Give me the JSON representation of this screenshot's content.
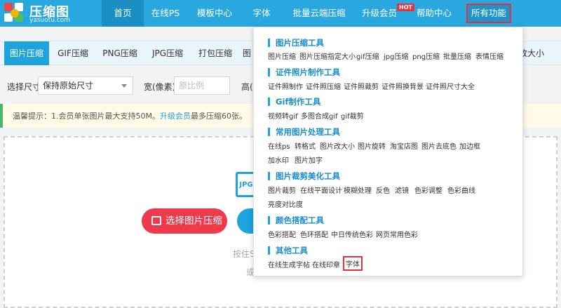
{
  "logo": {
    "title": "压缩图",
    "subtitle": "yasuotu.com"
  },
  "nav": {
    "items": [
      "首页",
      "在线PS",
      "模板中心",
      "字体",
      "批量云端压缩",
      "升级会员",
      "帮助中心"
    ],
    "hot_badge": "HOT",
    "all_functions": "所有功能"
  },
  "tabs": {
    "items": [
      "图片压缩",
      "GIF压缩",
      "PNG压缩",
      "JPG压缩",
      "打包压缩",
      "图"
    ],
    "right_label": "改大小"
  },
  "options": {
    "size_label": "选择尺寸",
    "size_value": "保持原始尺寸",
    "width_label": "宽(像素)",
    "width_placeholder": "原比例",
    "height_label": "高("
  },
  "notice": {
    "prefix": "温馨提示：1.会员单张图片最大支持50M。",
    "link": "升级会员",
    "suffix": "最多压缩60张。"
  },
  "upload": {
    "file_icon_label": "JPG",
    "select_button": "选择图片压缩",
    "hint_line1": "按住S",
    "hint_line2": "或"
  },
  "menu": {
    "sections": [
      {
        "title": "图片压缩工具",
        "tools": [
          "图片压缩",
          "图片压缩指定大小",
          "gif压缩",
          "jpg压缩",
          "png压缩",
          "批量压缩",
          "表情压缩"
        ]
      },
      {
        "title": "证件照片制作工具",
        "tools": [
          "证件照制作",
          "证件照压缩",
          "证件照裁剪",
          "证件照换背景",
          "证件照尺寸大全"
        ]
      },
      {
        "title": "Gif制作工具",
        "tools": [
          "视频转gif",
          "多图合成gif",
          "gif裁剪"
        ]
      },
      {
        "title": "常用图片处理工具",
        "tools": [
          "在线ps",
          "转格式",
          "图片改大小",
          "图片旋转",
          "淘宝店图",
          "图片去底色",
          "加边框",
          "加水印",
          "图片加字"
        ]
      },
      {
        "title": "图片裁剪美化工具",
        "tools": [
          "图片裁剪",
          "在线平面设计",
          "模糊处理",
          "反色",
          "滤镜",
          "色彩调整",
          "色彩曲线",
          "亮度对比度"
        ]
      },
      {
        "title": "颜色搭配工具",
        "tools": [
          "色彩搭配",
          "色环搭配",
          "中日传统色彩",
          "网页常用色彩"
        ]
      },
      {
        "title": "其他工具",
        "tools": [
          "在线生成字帖",
          "在线印章",
          "字体"
        ]
      }
    ]
  },
  "colors": {
    "brand": "#29a8e0",
    "accent": "#e8313a",
    "button": "#ee3a4b"
  }
}
